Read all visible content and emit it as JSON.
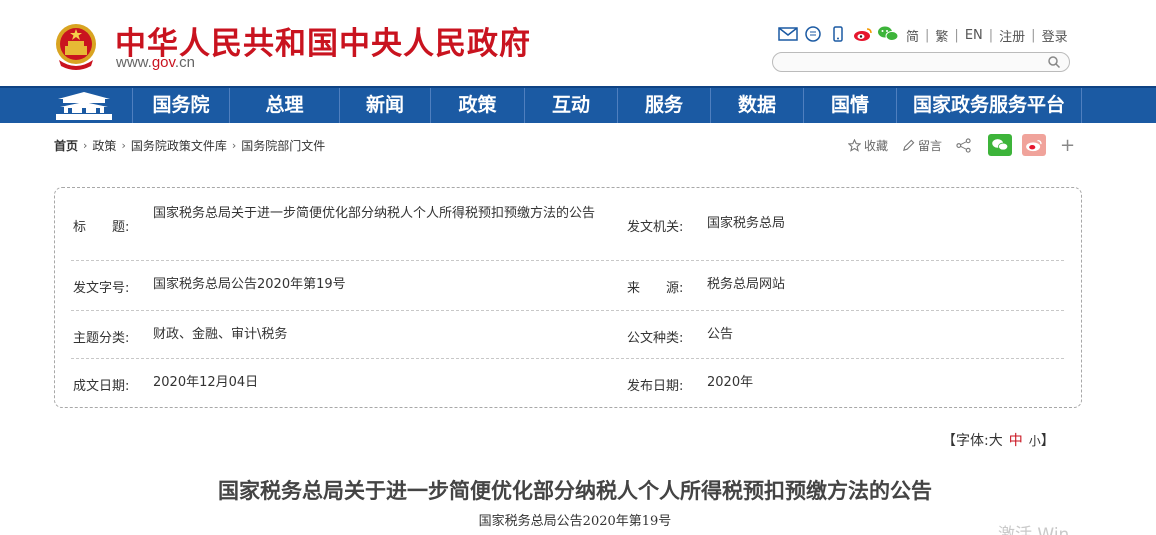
{
  "header": {
    "site_title": "中华人民共和国中央人民政府",
    "url_prefix": "www.",
    "url_gov": "gov",
    "url_suffix": ".cn",
    "icons": [
      "mail-icon",
      "message-icon",
      "mobile-icon",
      "weibo-icon",
      "wechat-icon"
    ],
    "links": [
      "简",
      "繁",
      "EN",
      "注册",
      "登录"
    ],
    "search_placeholder": ""
  },
  "nav": {
    "items": [
      "国务院",
      "总理",
      "新闻",
      "政策",
      "互动",
      "服务",
      "数据",
      "国情",
      "国家政务服务平台"
    ]
  },
  "breadcrumb": [
    "首页",
    "政策",
    "国务院政策文件库",
    "国务院部门文件"
  ],
  "tools": {
    "favorite": "收藏",
    "comment": "留言"
  },
  "info": {
    "title_label": "标　　题:",
    "title_value": "国家税务总局关于进一步简便优化部分纳税人个人所得税预扣预缴方法的公告",
    "issuer_label": "发文机关:",
    "issuer_value": "国家税务总局",
    "docno_label": "发文字号:",
    "docno_value": "国家税务总局公告2020年第19号",
    "source_label": "来　　源:",
    "source_value": "税务总局网站",
    "topic_label": "主题分类:",
    "topic_value": "财政、金融、审计\\税务",
    "type_label": "公文种类:",
    "type_value": "公告",
    "date_label": "成文日期:",
    "date_value": "2020年12月04日",
    "pub_label": "发布日期:",
    "pub_value": "2020年"
  },
  "font_selector": {
    "prefix": "【字体:",
    "large": "大",
    "medium": "中",
    "small": "小",
    "suffix": "】"
  },
  "document": {
    "title": "国家税务总局关于进一步简便优化部分纳税人个人所得税预扣预缴方法的公告",
    "number": "国家税务总局公告2020年第19号"
  },
  "watermark": "激活 Win",
  "colors": {
    "brand_red": "#c9131f",
    "nav_blue": "#1b5aa3"
  }
}
